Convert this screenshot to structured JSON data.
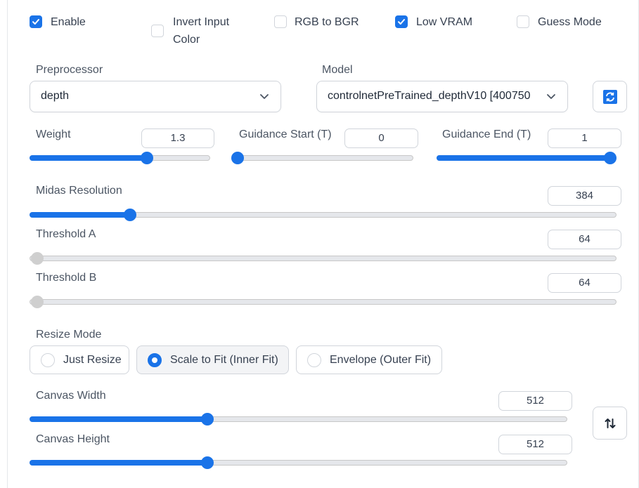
{
  "checkboxes": {
    "enable": {
      "label": "Enable",
      "checked": true
    },
    "invert_line1": "Invert Input",
    "invert_line2": "Color",
    "rgb_bgr": {
      "label": "RGB to BGR",
      "checked": false
    },
    "low_vram": {
      "label": "Low VRAM",
      "checked": true
    },
    "guess_mode": {
      "label": "Guess Mode",
      "checked": false
    }
  },
  "preprocessor": {
    "label": "Preprocessor",
    "value": "depth"
  },
  "model": {
    "label": "Model",
    "value": "controlnetPreTrained_depthV10 [400750"
  },
  "weight": {
    "label": "Weight",
    "value": "1.3",
    "fraction": 0.65
  },
  "guidance_start": {
    "label": "Guidance Start (T)",
    "value": "0",
    "fraction": 0.0
  },
  "guidance_end": {
    "label": "Guidance End (T)",
    "value": "1",
    "fraction": 1.0
  },
  "midas_resolution": {
    "label": "Midas Resolution",
    "value": "384",
    "fraction": 0.17
  },
  "threshold_a": {
    "label": "Threshold A",
    "value": "64"
  },
  "threshold_b": {
    "label": "Threshold B",
    "value": "64"
  },
  "resize_mode": {
    "label": "Resize Mode",
    "options": [
      "Just Resize",
      "Scale to Fit (Inner Fit)",
      "Envelope (Outer Fit)"
    ],
    "selected": "Scale to Fit (Inner Fit)"
  },
  "canvas_width": {
    "label": "Canvas Width",
    "value": "512",
    "fraction": 0.33
  },
  "canvas_height": {
    "label": "Canvas Height",
    "value": "512",
    "fraction": 0.33
  },
  "colors": {
    "accent": "#1a73e8",
    "disabled": "#cfcfcf"
  },
  "icons": {
    "refresh": "refresh-icon",
    "swap": "swap-vertical-icon",
    "chevron": "chevron-down-icon"
  }
}
